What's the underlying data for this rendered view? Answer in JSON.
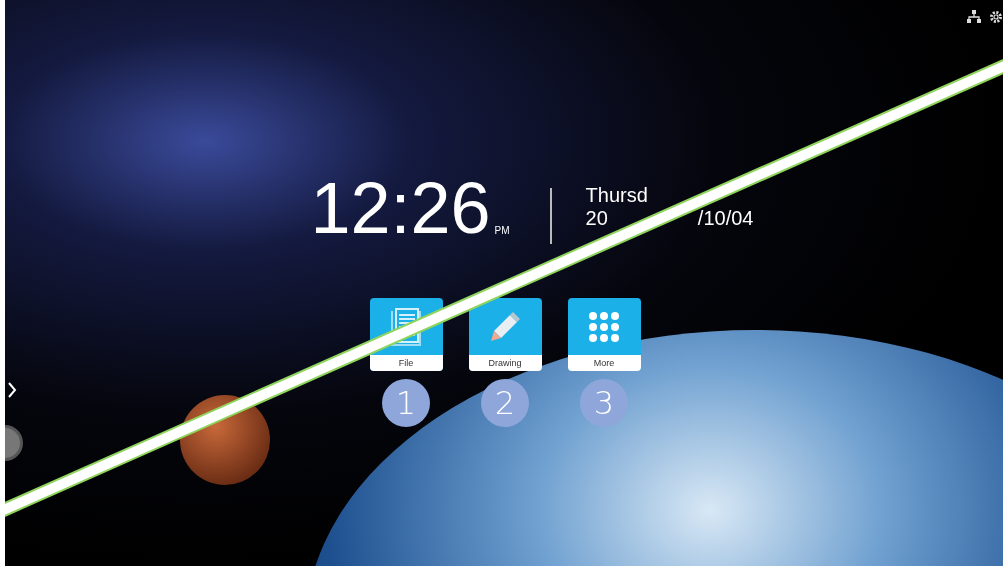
{
  "clock": {
    "time": "12:26",
    "meridiem": "PM",
    "day": "Thursd",
    "date_parts": [
      "20",
      "/10/04"
    ]
  },
  "apps": [
    {
      "kind": "file",
      "label": "File",
      "callout": "1"
    },
    {
      "kind": "drawing",
      "label": "Drawing",
      "callout": "2"
    },
    {
      "kind": "more",
      "label": "More",
      "callout": "3"
    }
  ]
}
